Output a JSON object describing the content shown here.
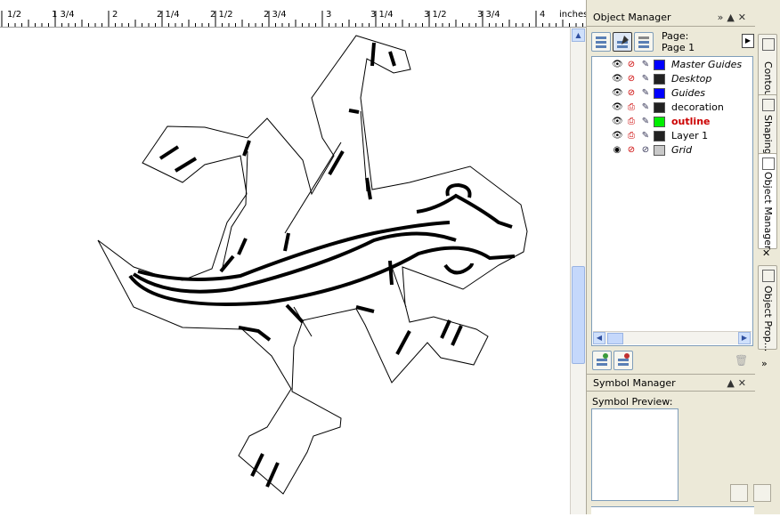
{
  "ruler": {
    "labels": [
      "1/2",
      "1 3/4",
      "2",
      "2 1/4",
      "2 1/2",
      "2 3/4",
      "3",
      "3 1/4",
      "3 1/2",
      "3 3/4",
      "4",
      "inches"
    ]
  },
  "object_manager": {
    "title": "Object Manager",
    "page_label": "Page:",
    "page_name": "Page 1",
    "layers": [
      {
        "name": "Master Guides",
        "color": "#0000ff",
        "style": "italic"
      },
      {
        "name": "Desktop",
        "color": "#222222",
        "style": "italic"
      },
      {
        "name": "Guides",
        "color": "#0000ff",
        "style": "italic"
      },
      {
        "name": "decoration",
        "color": "#222222",
        "style": "normal"
      },
      {
        "name": "outline",
        "color": "#00ee00",
        "style": "active"
      },
      {
        "name": "Layer 1",
        "color": "#222222",
        "style": "normal"
      },
      {
        "name": "Grid",
        "color": "#c8c8c8",
        "style": "italic"
      }
    ]
  },
  "tabs": {
    "contour": "Contour",
    "shaping": "Shaping",
    "object_manager": "Object Manager",
    "object_properties": "Object Prop..."
  },
  "symbol_manager": {
    "title": "Symbol Manager",
    "preview_label": "Symbol Preview:"
  },
  "colors": {
    "active_layer_text": "#cc0000",
    "panel_bg": "#ece9d8"
  }
}
